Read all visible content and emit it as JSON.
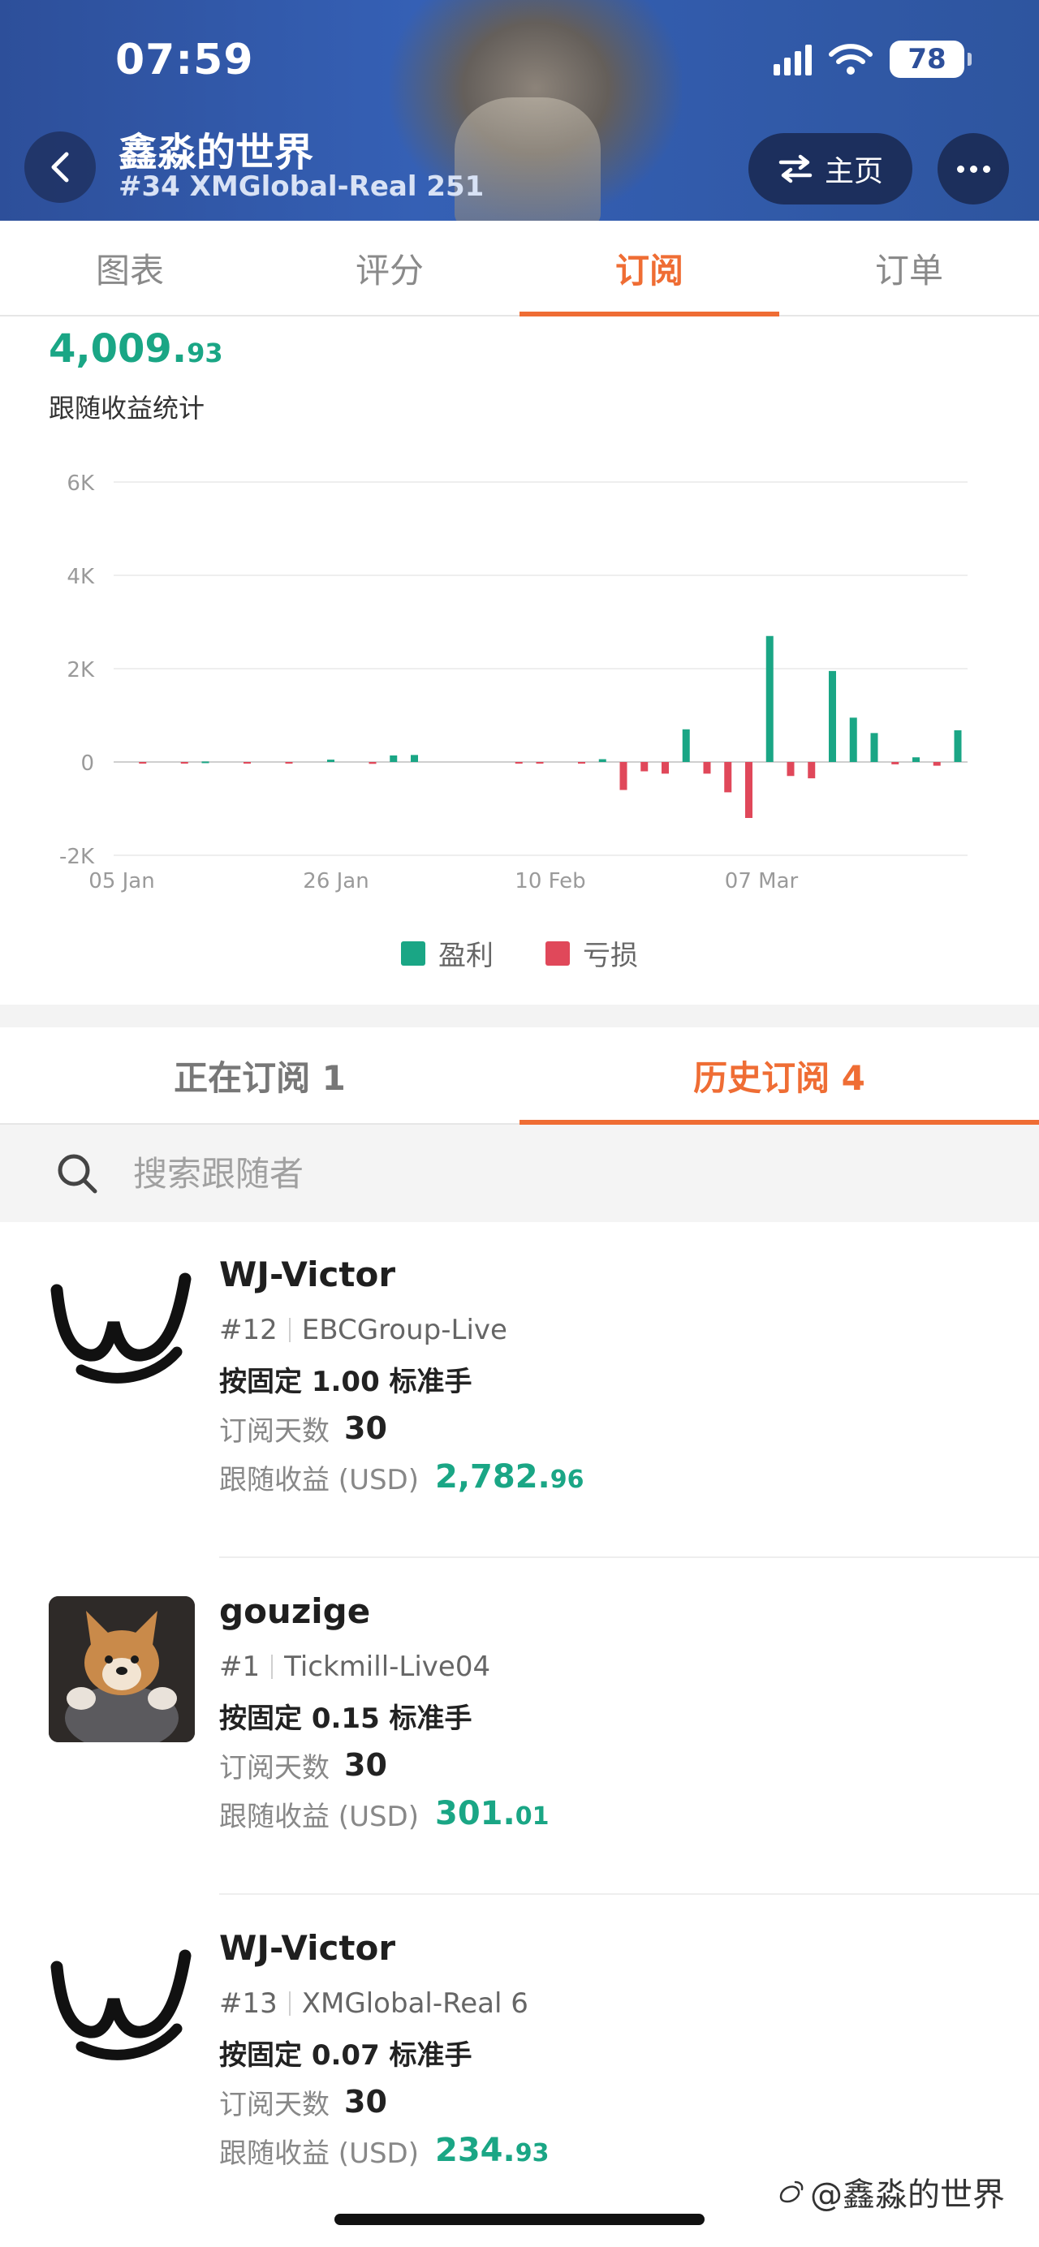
{
  "status_bar": {
    "time": "07:59",
    "battery": "78"
  },
  "header": {
    "title": "鑫淼的世界",
    "subtitle": "#34 XMGlobal-Real 251",
    "home_label": "主页"
  },
  "tabs": [
    {
      "label": "图表"
    },
    {
      "label": "评分"
    },
    {
      "label": "订阅",
      "active": true
    },
    {
      "label": "订单"
    }
  ],
  "summary": {
    "total_main": "4,009.",
    "total_decimal": "93",
    "label": "跟随收益统计"
  },
  "chart_data": {
    "type": "bar",
    "y_ticks": [
      "6K",
      "4K",
      "2K",
      "0",
      "-2K"
    ],
    "ylim": [
      -2000,
      6000
    ],
    "x_ticks": [
      "05 Jan",
      "26 Jan",
      "10 Feb",
      "07 Mar"
    ],
    "legend": [
      {
        "name": "盈利",
        "color": "#1aa685"
      },
      {
        "name": "亏损",
        "color": "#e0485a"
      }
    ],
    "grid": true,
    "values": [
      0,
      -20,
      0,
      -15,
      10,
      0,
      -10,
      0,
      -20,
      0,
      50,
      0,
      -40,
      140,
      150,
      0,
      0,
      0,
      0,
      -30,
      -10,
      0,
      -20,
      60,
      -600,
      -200,
      -250,
      700,
      -250,
      -650,
      -1200,
      2700,
      -300,
      -350,
      1950,
      950,
      620,
      -50,
      100,
      -80,
      680
    ]
  },
  "legend_labels": {
    "profit": "盈利",
    "loss": "亏损"
  },
  "subtabs": [
    {
      "label": "正在订阅 1"
    },
    {
      "label": "历史订阅 4",
      "active": true
    }
  ],
  "search": {
    "placeholder": "搜索跟随者"
  },
  "items": [
    {
      "name": "WJ-Victor",
      "rank": "#12",
      "broker": "EBCGroup-Live",
      "mode": "按固定 1.00 标准手",
      "days_label": "订阅天数",
      "days": "30",
      "profit_label": "跟随收益 (USD)",
      "profit_main": "2,782.",
      "profit_decimal": "96"
    },
    {
      "name": "gouzige",
      "rank": "#1",
      "broker": "Tickmill-Live04",
      "mode": "按固定 0.15 标准手",
      "days_label": "订阅天数",
      "days": "30",
      "profit_label": "跟随收益 (USD)",
      "profit_main": "301.",
      "profit_decimal": "01"
    },
    {
      "name": "WJ-Victor",
      "rank": "#13",
      "broker": "XMGlobal-Real 6",
      "mode": "按固定 0.07 标准手",
      "days_label": "订阅天数",
      "days": "30",
      "profit_label": "跟随收益 (USD)",
      "profit_main": "234.",
      "profit_decimal": "93"
    }
  ],
  "watermark": "@鑫淼的世界",
  "colors": {
    "accent": "#ef6d34",
    "profit": "#1aa685",
    "loss": "#e0485a",
    "header": "#2d4f9a"
  }
}
